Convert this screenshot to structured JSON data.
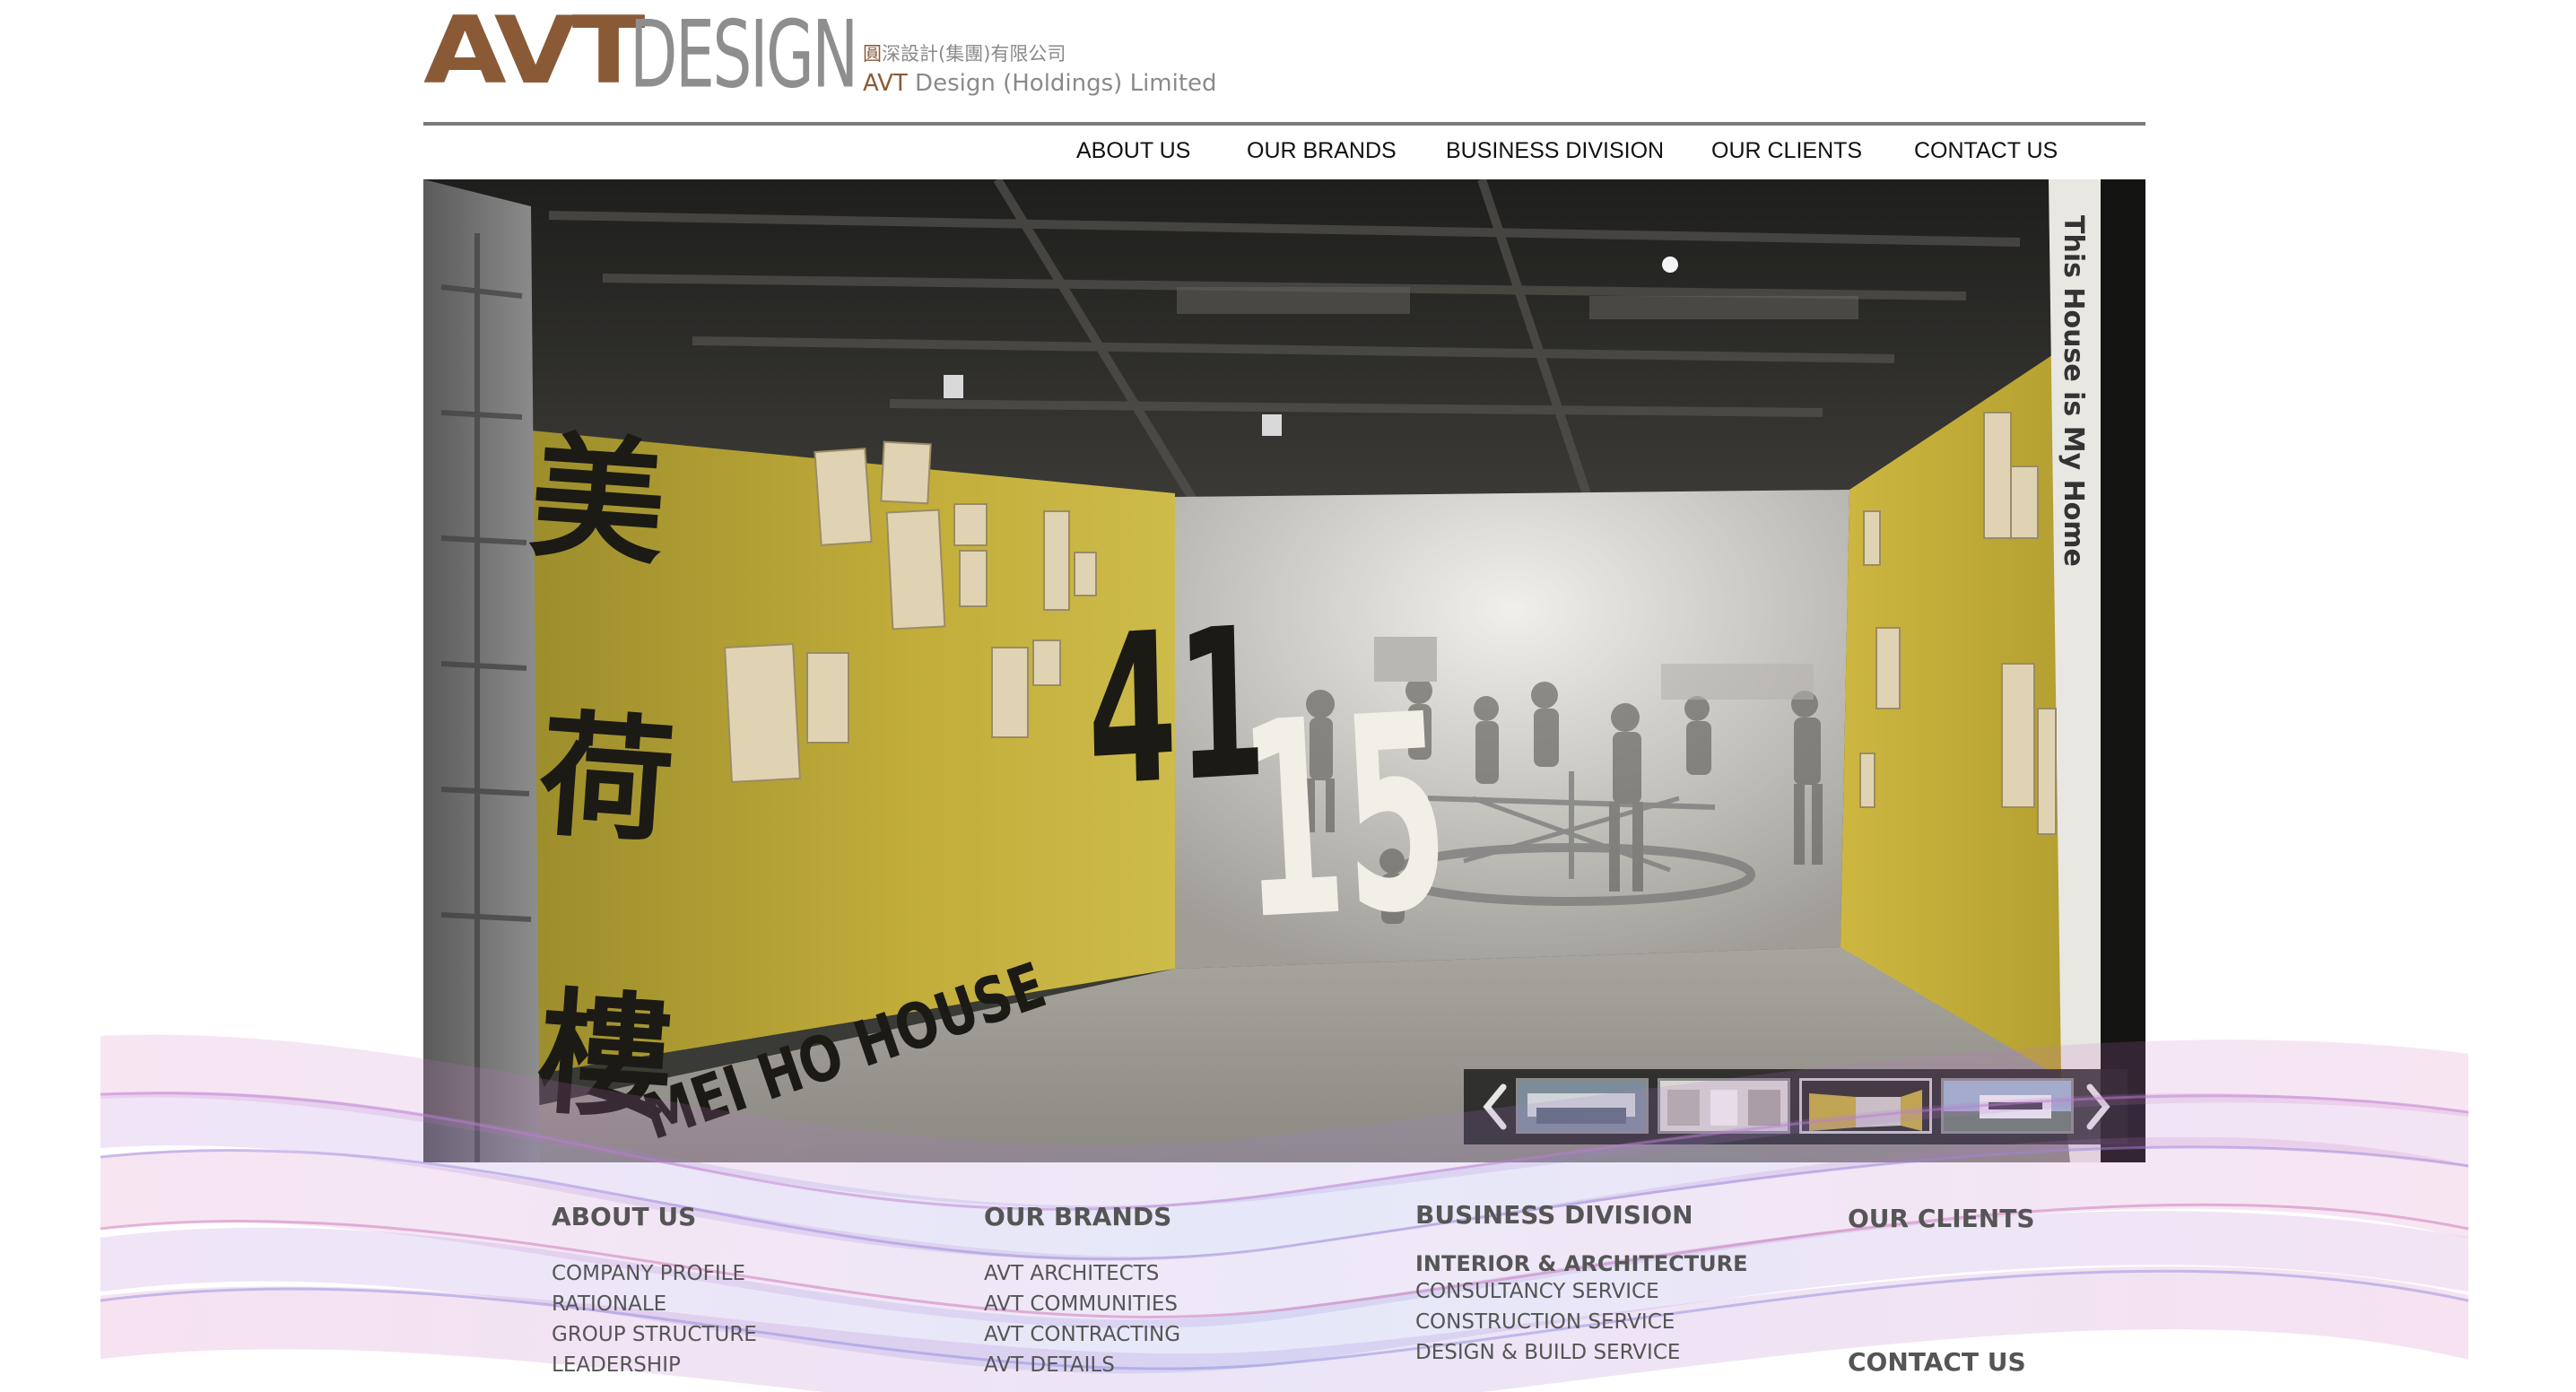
{
  "logo": {
    "main_left": "AVT",
    "main_right": "DESIGN",
    "chinese_brand_char": "圓",
    "chinese_rest": "深設計(集團)有限公司",
    "english_brand": "AVT",
    "english_rest": " Design (Holdings) Limited"
  },
  "nav": {
    "items": [
      {
        "label": "ABOUT US"
      },
      {
        "label": "OUR BRANDS"
      },
      {
        "label": "BUSINESS DIVISION"
      },
      {
        "label": "OUR CLIENTS"
      },
      {
        "label": "CONTACT US"
      }
    ]
  },
  "hero": {
    "wall_chinese": [
      "美",
      "荷",
      "樓"
    ],
    "wall_english": "MEI HO HOUSE",
    "wall_number_left": "41",
    "wall_number_right": "15",
    "pillar_text": "This House is My Home",
    "thumbnails_count": 4,
    "active_thumbnail": 3
  },
  "footer": {
    "about": {
      "heading": "ABOUT US",
      "links": [
        "COMPANY PROFILE",
        "RATIONALE",
        "GROUP STRUCTURE",
        "LEADERSHIP"
      ]
    },
    "brands": {
      "heading": "OUR BRANDS",
      "links": [
        "AVT ARCHITECTS",
        "AVT COMMUNITIES",
        "AVT CONTRACTING",
        "AVT DETAILS"
      ]
    },
    "business": {
      "heading": "BUSINESS DIVISION",
      "subheading": "INTERIOR & ARCHITECTURE",
      "links": [
        "CONSULTANCY SERVICE",
        "CONSTRUCTION SERVICE",
        "DESIGN & BUILD SERVICE"
      ]
    },
    "clients": {
      "heading": "OUR CLIENTS"
    },
    "contact": {
      "heading": "CONTACT US"
    }
  },
  "colors": {
    "brand_brown": "#8a5a37",
    "logo_gray": "#8e8e8e",
    "footer_text": "#555555",
    "wall_yellow": "#c9b53a"
  }
}
